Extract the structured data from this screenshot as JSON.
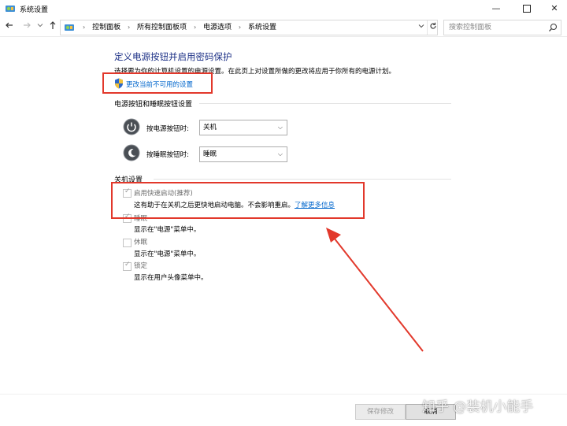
{
  "window": {
    "title": "系统设置",
    "minimize": "—",
    "close": "✕"
  },
  "address_bar": {
    "breadcrumbs": [
      "控制面板",
      "所有控制面板项",
      "电源选项",
      "系统设置"
    ],
    "search_placeholder": "搜索控制面板"
  },
  "page": {
    "title": "定义电源按钮并启用密码保护",
    "description": "选择要为你的计算机设置的电源设置。在此页上对设置所做的更改将应用于你所有的电源计划。",
    "change_link": "更改当前不可用的设置"
  },
  "power_buttons": {
    "section_title": "电源按钮和睡眠按钮设置",
    "rows": [
      {
        "label": "按电源按钮时:",
        "value": "关机"
      },
      {
        "label": "按睡眠按钮时:",
        "value": "睡眠"
      }
    ]
  },
  "shutdown": {
    "section_title": "关机设置",
    "options": [
      {
        "label": "启用快速启动(推荐)",
        "desc": "这有助于在关机之后更快地启动电脑。不会影响重启。",
        "link": "了解更多信息",
        "checked": true
      },
      {
        "label": "睡眠",
        "desc": "显示在\"电源\"菜单中。",
        "checked": true
      },
      {
        "label": "休眠",
        "desc": "显示在\"电源\"菜单中。",
        "checked": false
      },
      {
        "label": "锁定",
        "desc": "显示在用户头像菜单中。",
        "checked": true
      }
    ]
  },
  "footer": {
    "save_label": "保存修改",
    "cancel_label": "取消"
  },
  "watermark": "知乎 @装机小能手",
  "colors": {
    "title_blue": "#1e3287",
    "link_blue": "#0066cc",
    "annotation_red": "#e2382b"
  },
  "icons": [
    "control-panel-icon",
    "back-arrow-icon",
    "forward-arrow-icon",
    "up-arrow-icon",
    "refresh-icon",
    "search-icon",
    "shield-icon",
    "power-button-icon",
    "sleep-button-icon"
  ]
}
